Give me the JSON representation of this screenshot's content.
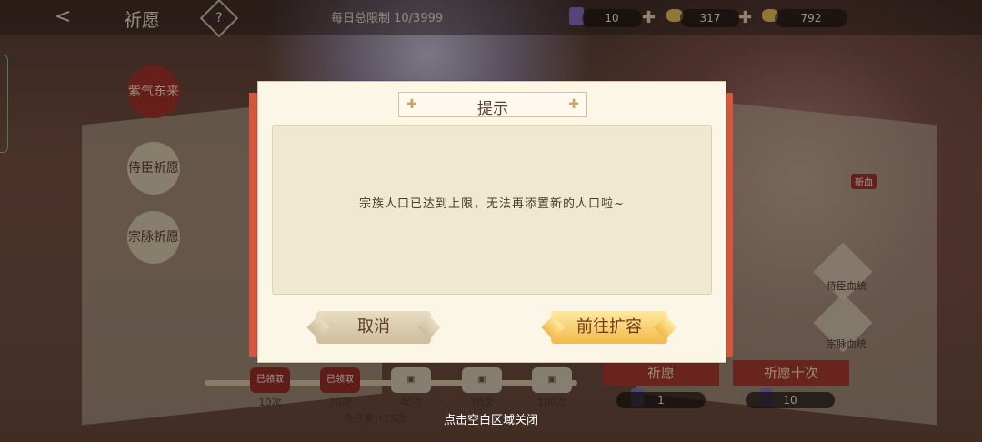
{
  "header": {
    "back_glyph": "<",
    "title": "祈愿",
    "help_glyph": "?",
    "daily_limit": "每日总限制 10/3999"
  },
  "resources": {
    "ticket": "10",
    "gold": "317",
    "ingot": "792"
  },
  "sidebar": {
    "items": [
      {
        "label": "紫气东来",
        "active": true
      },
      {
        "label": "侍臣祈愿",
        "active": false
      },
      {
        "label": "宗脉祈愿",
        "active": false
      }
    ]
  },
  "progress": {
    "milestones": [
      {
        "count": "10次",
        "status": "已领取"
      },
      {
        "count": "30次",
        "status": "已领取"
      },
      {
        "count": "40次",
        "status": ""
      },
      {
        "count": "70次",
        "status": ""
      },
      {
        "count": "100次",
        "status": ""
      }
    ],
    "total": "今日累计25次"
  },
  "right_panel": {
    "new_tag": "新血",
    "btn1": "侍臣血统",
    "btn2": "宗脉血统"
  },
  "actions": {
    "pray_one": "祈愿",
    "pray_ten": "祈愿十次",
    "cost_one": "1",
    "cost_ten": "10"
  },
  "dialog": {
    "title": "提示",
    "message": "宗族人口已达到上限，无法再添置新的人口啦~",
    "cancel": "取消",
    "confirm": "前往扩容"
  },
  "footer_hint": "点击空白区域关闭",
  "colors": {
    "accent_red": "#a7322b",
    "gold_button": "#f1b948",
    "dialog_bg": "#fbf6e6"
  }
}
